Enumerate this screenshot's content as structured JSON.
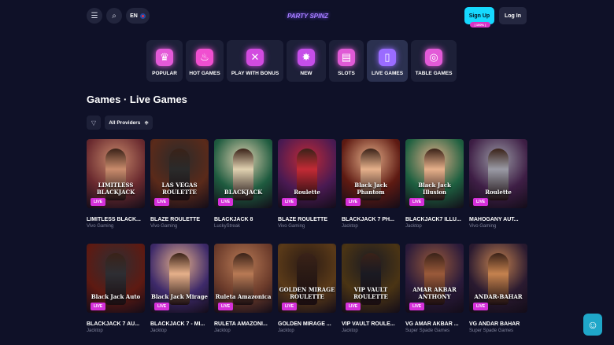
{
  "header": {
    "menu_icon": "hamburger-icon",
    "search_icon": "search-icon",
    "language": "EN",
    "logo_text": "PARTY SPINZ",
    "signup_label": "Sign Up",
    "signup_badge": "| 100% |",
    "login_label": "Log In"
  },
  "categories": [
    {
      "label": "POPULAR",
      "icon": "crown-icon",
      "color": "#e45ad8",
      "active": false
    },
    {
      "label": "HOT GAMES",
      "icon": "flame-icon",
      "color": "#f04fd0",
      "active": false
    },
    {
      "label": "PLAY WITH BONUS",
      "icon": "bonus-x2-icon",
      "color": "#d24be0",
      "active": false
    },
    {
      "label": "NEW",
      "icon": "new-badge-icon",
      "color": "#c64ee9",
      "active": false
    },
    {
      "label": "SLOTS",
      "icon": "slot-machine-icon",
      "color": "#e05ad6",
      "active": false
    },
    {
      "label": "LIVE GAMES",
      "icon": "live-phone-icon",
      "color": "#9a6cff",
      "active": true
    },
    {
      "label": "TABLE GAMES",
      "icon": "roulette-table-icon",
      "color": "#e35ad8",
      "active": false
    }
  ],
  "page": {
    "title": "Games · Live Games",
    "filter_icon": "funnel-icon",
    "providers_label": "All Providers"
  },
  "live_badge": "LIVE",
  "games": [
    {
      "name": "LIMITLESS BLACK...",
      "provider": "Vivo Gaming",
      "caption": "LIMITLESS BLACKJACK",
      "bg": "#6a2a2f",
      "accent": "#c98b6c"
    },
    {
      "name": "BLAZE ROULETTE",
      "provider": "Vivo Gaming",
      "caption": "LAS VEGAS ROULETTE",
      "bg": "#5a2a1a",
      "accent": "#2a2a2a"
    },
    {
      "name": "BLACKJACK 8",
      "provider": "LuckyStreak",
      "caption": "BLACKJACK",
      "bg": "#1e5b3f",
      "accent": "#e0d1b0"
    },
    {
      "name": "BLAZE ROULETTE",
      "provider": "Vivo Gaming",
      "caption": "Roulette",
      "bg": "#4a1a52",
      "accent": "#c22a35"
    },
    {
      "name": "BLACKJACK 7 PH...",
      "provider": "Jacktop",
      "caption": "Black Jack Phantom",
      "bg": "#5e1a12",
      "accent": "#e6b08a"
    },
    {
      "name": "BLACKJACK7 ILLU...",
      "provider": "Jacktop",
      "caption": "Black Jack Illusion",
      "bg": "#1e6040",
      "accent": "#e6b08a"
    },
    {
      "name": "MAHOGANY AUT...",
      "provider": "Vivo Gaming",
      "caption": "Roulette",
      "bg": "#3e1e45",
      "accent": "#9a9aa5"
    },
    {
      "name": "BLACKJACK 7 AU...",
      "provider": "Jacktop",
      "caption": "Black Jack Auto",
      "bg": "#5e1a12",
      "accent": "#2e2e33"
    },
    {
      "name": "BLACKJACK 7 - MI...",
      "provider": "Jacktop",
      "caption": "Black Jack Mirage",
      "bg": "#3e2a6a",
      "accent": "#e6b08a"
    },
    {
      "name": "RULETA AMAZONI...",
      "provider": "Jacktop",
      "caption": "Ruleta Amazonica",
      "bg": "#6a3a2a",
      "accent": "#b87a55"
    },
    {
      "name": "GOLDEN MIRAGE ...",
      "provider": "Jacktop",
      "caption": "GOLDEN MIRAGE ROULETTE",
      "bg": "#5a3a18",
      "accent": "#2a1a14"
    },
    {
      "name": "VIP VAULT ROULE...",
      "provider": "Jacktop",
      "caption": "VIP VAULT ROULETTE",
      "bg": "#4a3414",
      "accent": "#1a1a22"
    },
    {
      "name": "VG AMAR AKBAR ...",
      "provider": "Super Spade Games",
      "caption": "AMAR AKBAR ANTHONY",
      "bg": "#2a1a3a",
      "accent": "#9a5a3a"
    },
    {
      "name": "VG ANDAR BAHAR",
      "provider": "Super Spade Games",
      "caption": "ANDAR-BAHAR",
      "bg": "#2a1a30",
      "accent": "#c5824f"
    }
  ],
  "chat_widget_icon": "support-chat-icon"
}
